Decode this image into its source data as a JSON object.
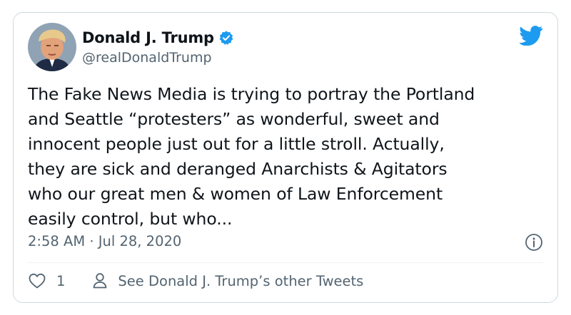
{
  "tweet": {
    "display_name": "Donald J. Trump",
    "handle": "@realDonaldTrump",
    "verified_icon": "verified-badge-icon",
    "brand_icon": "twitter-bird-icon",
    "text": "The Fake News Media is trying to portray the Portland\nand Seattle “protesters” as wonderful, sweet and\ninnocent people just out for a little stroll. Actually,\nthey are sick and deranged Anarchists & Agitators\nwho our great men & women of Law Enforcement\neasily control, but who...",
    "timestamp": "2:58 AM · Jul 28, 2020",
    "like_count": "1",
    "other_tweets_label": "See Donald J. Trump’s other Tweets"
  },
  "colors": {
    "brand": "#1d9bf0",
    "text_primary": "#0f1419",
    "text_secondary": "#536471",
    "border": "#cfd9de"
  }
}
